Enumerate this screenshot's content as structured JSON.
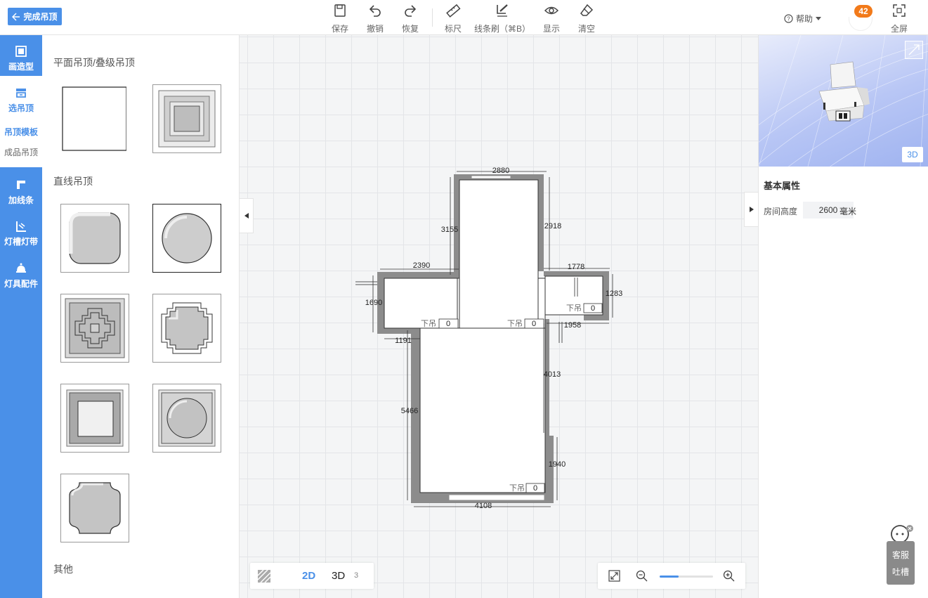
{
  "header": {
    "back_label": "完成吊顶",
    "tools": [
      {
        "label": "保存",
        "icon": "save-icon"
      },
      {
        "label": "撤销",
        "icon": "undo-icon"
      },
      {
        "label": "恢复",
        "icon": "redo-icon"
      },
      {
        "label": "标尺",
        "icon": "ruler-icon"
      },
      {
        "label": "线条刷（⌘B）",
        "icon": "line-brush-icon"
      },
      {
        "label": "显示",
        "icon": "eye-icon"
      },
      {
        "label": "清空",
        "icon": "eraser-icon"
      }
    ],
    "help_label": "帮助",
    "message_count": "42",
    "fullscreen_label": "全屏"
  },
  "rail": {
    "items": [
      {
        "label": "画造型",
        "icon": "draw-shape-icon"
      },
      {
        "label": "选吊顶",
        "icon": "ceiling-select-icon"
      },
      {
        "label": "加线条",
        "icon": "add-line-icon"
      },
      {
        "label": "灯槽灯带",
        "icon": "light-trough-icon"
      },
      {
        "label": "灯具配件",
        "icon": "lamp-icon"
      }
    ],
    "sub_items": [
      "吊顶模板",
      "成品吊顶"
    ]
  },
  "catalog": {
    "sections": [
      "平面吊顶/叠级吊顶",
      "直线吊顶",
      "其他"
    ]
  },
  "plan": {
    "dimensions": [
      "2880",
      "3155",
      "2918",
      "2390",
      "1778",
      "1690",
      "1283",
      "1958",
      "1191",
      "4013",
      "5466",
      "1940",
      "4108"
    ],
    "ceiling_label": "下吊",
    "ceiling_values": [
      "0",
      "0",
      "0",
      "0"
    ]
  },
  "view_controls": {
    "mode_2d": "2D",
    "mode_3d": "3D",
    "mode_3d_badge": "3"
  },
  "zoom": {
    "level": 0.35
  },
  "right_panel": {
    "preview_button": "3D",
    "properties_title": "基本属性",
    "room_height_label": "房间高度",
    "room_height_value": "2600",
    "room_height_unit": "毫米"
  },
  "service": {
    "line1": "客服",
    "line2": "吐槽"
  },
  "colors": {
    "accent": "#4a90e8",
    "badge": "#f27a1a",
    "wall": "#8c8c8c"
  }
}
